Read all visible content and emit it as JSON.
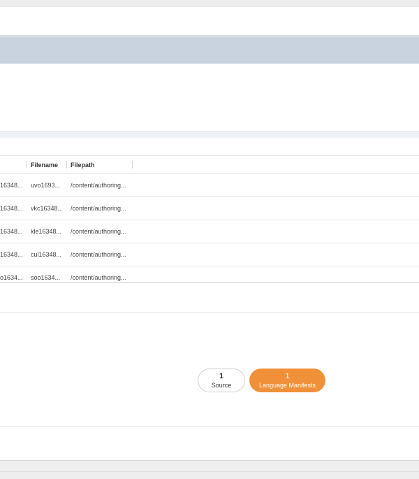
{
  "table": {
    "columns": [
      "Filename",
      "Filepath"
    ],
    "rows": [
      [
        "16348...",
        "uvo1693...",
        "/content/authoring..."
      ],
      [
        "16348...",
        "vkc16348...",
        "/content/authoring..."
      ],
      [
        "16348...",
        "kle16348...",
        "/content/authoring..."
      ],
      [
        "16348...",
        "cul16348...",
        "/content/authoring..."
      ],
      [
        "o1634...",
        "soo1634...",
        "/content/authoring..."
      ]
    ]
  },
  "summary": {
    "source": {
      "count": "1",
      "label": "Source"
    },
    "language_manifests": {
      "count": "1",
      "label": "Language Manifests"
    }
  },
  "colors": {
    "header_band": "#c8d3df",
    "accent_orange": "#f0913a"
  }
}
